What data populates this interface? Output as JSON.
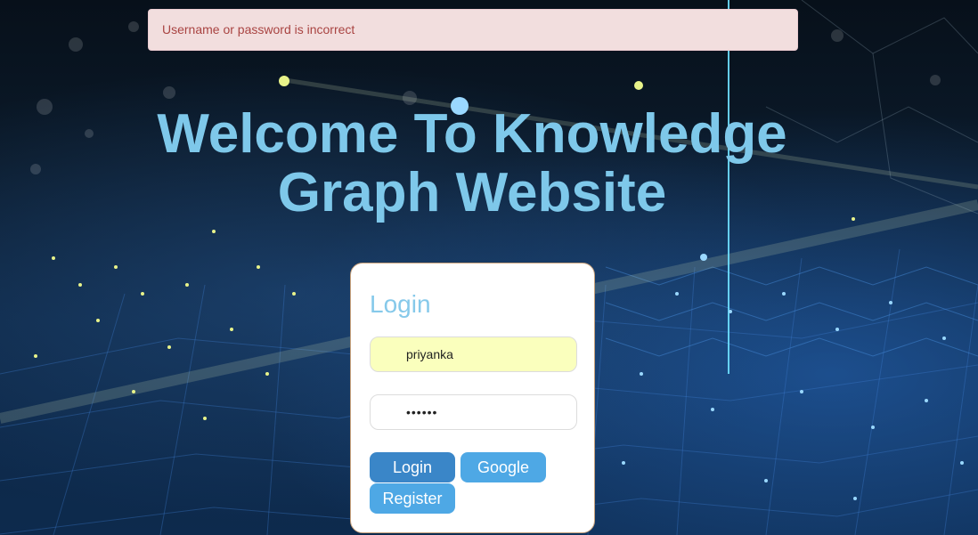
{
  "alert": {
    "message": "Username or password is incorrect"
  },
  "hero": {
    "title_line1": "Welcome To Knowledge",
    "title_line2": "Graph Website"
  },
  "login_form": {
    "title": "Login",
    "username_value": "priyanka",
    "password_value": "••••••",
    "buttons": {
      "login": "Login",
      "google": "Google",
      "register": "Register"
    }
  },
  "colors": {
    "accent": "#7ec8ea",
    "alert_bg": "#f2dede",
    "alert_text": "#a94442",
    "login_button": "#3a86c8",
    "secondary_button": "#4ea8e5",
    "autofill_bg": "#faffbd"
  }
}
